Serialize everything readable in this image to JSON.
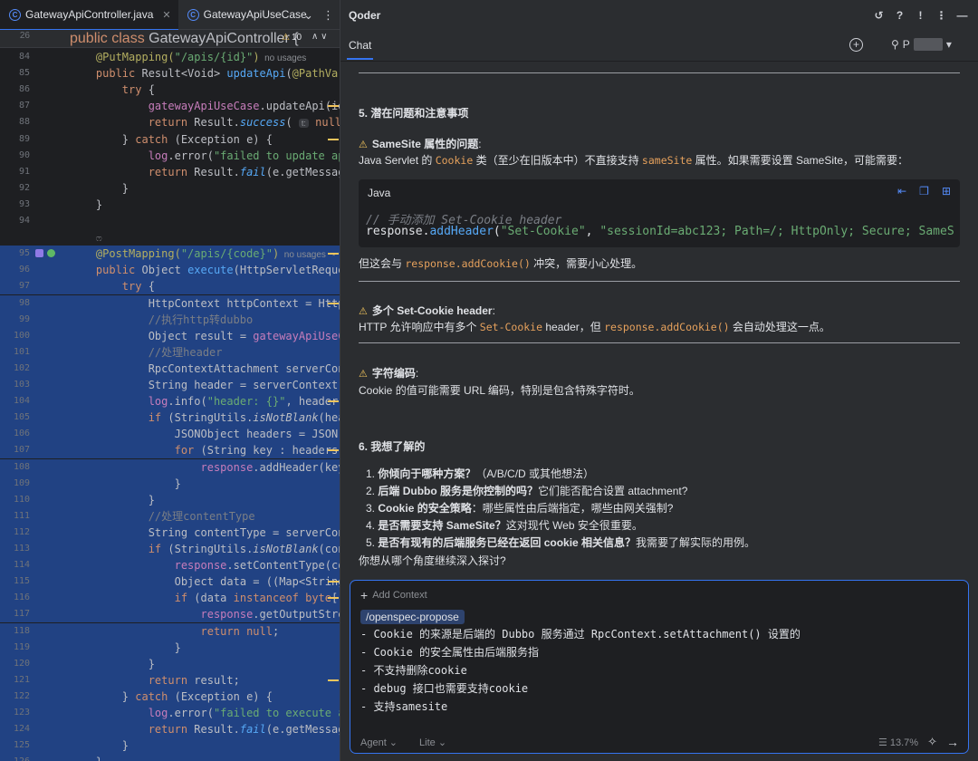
{
  "editor": {
    "tabs": [
      {
        "label": "GatewayApiController.java",
        "active": true
      },
      {
        "label": "GatewayApiUseCase",
        "active": false
      }
    ],
    "sticky": {
      "line_no": "26",
      "code": "public class GatewayApiController {",
      "warnings": "10"
    },
    "lines": [
      {
        "n": "84",
        "segs": [
          [
            "    ",
            ""
          ],
          [
            "@PutMapping(",
            "ann"
          ],
          [
            "\"/apis/{id}\"",
            "str"
          ],
          [
            ")",
            "ann"
          ],
          [
            "  no usages",
            "hint"
          ]
        ]
      },
      {
        "n": "85",
        "segs": [
          [
            "    public ",
            "kw"
          ],
          [
            "Result<Void> ",
            ""
          ],
          [
            "updateApi",
            "fn"
          ],
          [
            "(",
            ""
          ],
          [
            "@PathVariabl",
            "ann"
          ]
        ]
      },
      {
        "n": "86",
        "segs": [
          [
            "        try ",
            "kw"
          ],
          [
            "{",
            ""
          ]
        ]
      },
      {
        "n": "87",
        "segs": [
          [
            "            gatewayApiUseCase",
            "fld"
          ],
          [
            ".updateApi(id, up",
            ""
          ]
        ]
      },
      {
        "n": "88",
        "segs": [
          [
            "            return ",
            "kw"
          ],
          [
            "Result.",
            ""
          ],
          [
            "success",
            "fn it"
          ],
          [
            "( ",
            ""
          ],
          [
            "t:",
            "hintbox"
          ],
          [
            " null",
            "kw"
          ],
          [
            ");",
            ""
          ]
        ]
      },
      {
        "n": "89",
        "segs": [
          [
            "        } ",
            ""
          ],
          [
            "catch ",
            "kw"
          ],
          [
            "(Exception e) {",
            ""
          ]
        ]
      },
      {
        "n": "90",
        "segs": [
          [
            "            log",
            "fld"
          ],
          [
            ".error(",
            ""
          ],
          [
            "\"failed to update api\"",
            "str"
          ],
          [
            ", e",
            ""
          ]
        ]
      },
      {
        "n": "91",
        "segs": [
          [
            "            return ",
            "kw"
          ],
          [
            "Result.",
            ""
          ],
          [
            "fail",
            "fn it"
          ],
          [
            "(e.getMessage())",
            ""
          ]
        ]
      },
      {
        "n": "92",
        "segs": [
          [
            "        }",
            ""
          ]
        ]
      },
      {
        "n": "93",
        "segs": [
          [
            "    }",
            ""
          ]
        ]
      },
      {
        "n": "94",
        "segs": [
          [
            "",
            ""
          ]
        ]
      },
      {
        "n": "",
        "segs": [
          [
            "    ",
            ""
          ],
          [
            "ෆ",
            "hint"
          ]
        ]
      },
      {
        "n": "95",
        "segs": [
          [
            "    ",
            ""
          ],
          [
            "@PostMapping(",
            "ann"
          ],
          [
            "\"/apis/{code}\"",
            "str"
          ],
          [
            ")",
            "ann"
          ],
          [
            "  no usages",
            "hint"
          ],
          [
            "  ⋆ fu",
            "hint"
          ]
        ],
        "gutter": true
      },
      {
        "n": "96",
        "segs": [
          [
            "    public ",
            "kw"
          ],
          [
            "Object ",
            ""
          ],
          [
            "execute",
            "fn"
          ],
          [
            "(HttpServletRequest r",
            ""
          ]
        ]
      },
      {
        "n": "97",
        "segs": [
          [
            "        try ",
            "kw"
          ],
          [
            "{",
            ""
          ]
        ]
      },
      {
        "n": "98",
        "segs": [
          [
            "            HttpContext httpContext = HttpRequ",
            ""
          ]
        ]
      },
      {
        "n": "99",
        "segs": [
          [
            "            //执行http转dubbo",
            "cm"
          ]
        ]
      },
      {
        "n": "100",
        "segs": [
          [
            "            Object result = ",
            ""
          ],
          [
            "gatewayApiUseCase",
            "fld"
          ],
          [
            ".",
            ""
          ]
        ]
      },
      {
        "n": "101",
        "segs": [
          [
            "            //处理header",
            "cm"
          ]
        ]
      },
      {
        "n": "102",
        "segs": [
          [
            "            RpcContextAttachment serverContext",
            ""
          ]
        ]
      },
      {
        "n": "103",
        "segs": [
          [
            "            String header = serverContext.getA",
            ""
          ]
        ]
      },
      {
        "n": "104",
        "segs": [
          [
            "            log",
            "fld"
          ],
          [
            ".info(",
            ""
          ],
          [
            "\"header: {}\"",
            "str"
          ],
          [
            ", header);",
            ""
          ]
        ]
      },
      {
        "n": "105",
        "segs": [
          [
            "            if ",
            "kw"
          ],
          [
            "(StringUtils.",
            ""
          ],
          [
            "isNotBlank",
            "it"
          ],
          [
            "(header)",
            ""
          ]
        ]
      },
      {
        "n": "106",
        "segs": [
          [
            "                JSONObject headers = JSON.",
            ""
          ],
          [
            "pars",
            "it"
          ]
        ]
      },
      {
        "n": "107",
        "segs": [
          [
            "                for ",
            "kw"
          ],
          [
            "(String key : headers.keyS",
            ""
          ]
        ]
      },
      {
        "n": "108",
        "segs": [
          [
            "                    response",
            "fld"
          ],
          [
            ".addHeader(key, he",
            ""
          ]
        ]
      },
      {
        "n": "109",
        "segs": [
          [
            "                }",
            ""
          ]
        ]
      },
      {
        "n": "110",
        "segs": [
          [
            "            }",
            ""
          ]
        ]
      },
      {
        "n": "111",
        "segs": [
          [
            "            //处理contentType",
            "cm"
          ]
        ]
      },
      {
        "n": "112",
        "segs": [
          [
            "            String contentType = serverContext",
            ""
          ]
        ]
      },
      {
        "n": "113",
        "segs": [
          [
            "            if ",
            "kw"
          ],
          [
            "(StringUtils.",
            ""
          ],
          [
            "isNotBlank",
            "it"
          ],
          [
            "(content",
            ""
          ]
        ]
      },
      {
        "n": "114",
        "segs": [
          [
            "                response",
            "fld"
          ],
          [
            ".setContentType(conten",
            ""
          ]
        ]
      },
      {
        "n": "115",
        "segs": [
          [
            "                Object data = ((Map<String,Obj",
            ""
          ]
        ]
      },
      {
        "n": "116",
        "segs": [
          [
            "                if ",
            "kw"
          ],
          [
            "(data ",
            ""
          ],
          [
            "instanceof byte",
            "kw"
          ],
          [
            "[]) {",
            ""
          ]
        ]
      },
      {
        "n": "117",
        "segs": [
          [
            "                    response",
            "fld"
          ],
          [
            ".getOutputStream()",
            ""
          ]
        ]
      },
      {
        "n": "118",
        "segs": [
          [
            "                    return null",
            "kw"
          ],
          [
            ";",
            ""
          ]
        ]
      },
      {
        "n": "119",
        "segs": [
          [
            "                }",
            ""
          ]
        ]
      },
      {
        "n": "120",
        "segs": [
          [
            "            }",
            ""
          ]
        ]
      },
      {
        "n": "121",
        "segs": [
          [
            "            return ",
            "kw"
          ],
          [
            "result;",
            ""
          ]
        ]
      },
      {
        "n": "122",
        "segs": [
          [
            "        } ",
            ""
          ],
          [
            "catch ",
            "kw"
          ],
          [
            "(Exception e) {",
            ""
          ]
        ]
      },
      {
        "n": "123",
        "segs": [
          [
            "            log",
            "fld"
          ],
          [
            ".error(",
            ""
          ],
          [
            "\"failed to execute api\"",
            "str"
          ],
          [
            ", ",
            ""
          ]
        ]
      },
      {
        "n": "124",
        "segs": [
          [
            "            return ",
            "kw"
          ],
          [
            "Result.",
            ""
          ],
          [
            "fail",
            "fn it"
          ],
          [
            "(e.getMessage())",
            ""
          ]
        ]
      },
      {
        "n": "125",
        "segs": [
          [
            "        }",
            ""
          ]
        ]
      },
      {
        "n": "126",
        "segs": [
          [
            "    }",
            ""
          ]
        ]
      }
    ]
  },
  "chat": {
    "app_title": "Qoder",
    "tab_label": "Chat",
    "user_initial": "P",
    "messages": {
      "section5_title": "5. 潜在问题和注意事项",
      "samesite_title": "SameSite 属性的问题",
      "samesite_text_a": "Java Servlet 的 ",
      "samesite_code_cookie": "Cookie",
      "samesite_text_b": " 类（至少在旧版本中）不直接支持 ",
      "samesite_code_attr": "sameSite",
      "samesite_text_c": " 属性。如果需要设置 SameSite，可能需要：",
      "code_lang": "Java",
      "code_comment": "// 手动添加 Set-Cookie header",
      "code_obj": "response",
      "code_method": "addHeader",
      "code_arg1": "\"Set-Cookie\"",
      "code_arg2": "\"sessionId=abc123; Path=/; HttpOnly; Secure; SameS",
      "after_code_a": "但这会与 ",
      "after_code_code": "response.addCookie()",
      "after_code_b": " 冲突，需要小心处理。",
      "multi_title": "多个 Set-Cookie header",
      "multi_text_a": "HTTP 允许响应中有多个 ",
      "multi_code_a": "Set-Cookie",
      "multi_text_b": " header，但 ",
      "multi_code_b": "response.addCookie()",
      "multi_text_c": " 会自动处理这一点。",
      "enc_title": "字符编码",
      "enc_text": "Cookie 的值可能需要 URL 编码，特别是包含特殊字符时。",
      "section6_title": "6. 我想了解的",
      "questions": [
        {
          "num": "1.",
          "bold": "你倾向于哪种方案？",
          "rest": "（A/B/C/D 或其他想法）"
        },
        {
          "num": "2.",
          "bold": "后端 Dubbo 服务是你控制的吗？",
          "rest": "它们能否配合设置 attachment?"
        },
        {
          "num": "3.",
          "bold": "Cookie 的安全策略",
          "rest": "：哪些属性由后端指定，哪些由网关强制?"
        },
        {
          "num": "4.",
          "bold": "是否需要支持 SameSite？",
          "rest": "这对现代 Web 安全很重要。"
        },
        {
          "num": "5.",
          "bold": "是否有现有的后端服务已经在返回 cookie 相关信息？",
          "rest": "我需要了解实际的用例。"
        }
      ],
      "closing": "你想从哪个角度继续深入探讨?"
    },
    "input": {
      "add_context": "Add Context",
      "command_chip": "/openspec-propose",
      "lines": [
        "- Cookie 的来源是后端的 Dubbo 服务通过 RpcContext.setAttachment() 设置的",
        "- Cookie 的安全属性由后端服务指",
        "- 不支持删除cookie",
        "- debug 接口也需要支持cookie",
        "- 支持samesite"
      ],
      "mode": "Agent",
      "model": "Lite",
      "context_usage": "13.7%"
    }
  }
}
